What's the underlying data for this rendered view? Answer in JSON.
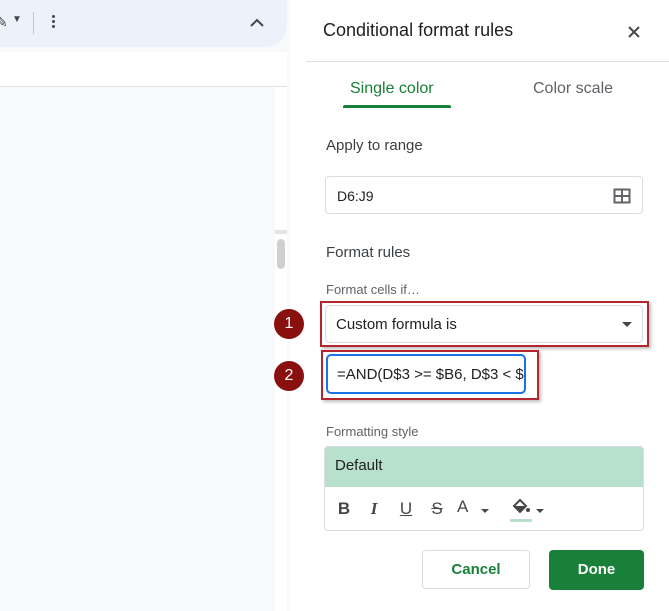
{
  "panel": {
    "title": "Conditional format rules",
    "close_icon": "close-icon",
    "tabs": [
      {
        "label": "Single color",
        "active": true
      },
      {
        "label": "Color scale",
        "active": false
      }
    ],
    "apply_to_range": {
      "heading": "Apply to range",
      "value": "D6:J9",
      "icon": "select-range-grid-icon"
    },
    "format_rules": {
      "heading": "Format rules",
      "condition_label": "Format cells if…",
      "condition_value": "Custom formula is",
      "formula_value": "=AND(D$3 >= $B6, D$3 < $"
    },
    "formatting_style": {
      "label": "Formatting style",
      "preview_text": "Default",
      "preview_color": "#b7e1cd",
      "tools": [
        "bold-icon",
        "italic-icon",
        "underline-icon",
        "strikethrough-icon",
        "text-color-icon",
        "fill-color-icon"
      ],
      "bold_label": "B",
      "italic_label": "I",
      "underline_label": "U",
      "strike_label": "S",
      "text_color_label": "A"
    },
    "buttons": {
      "cancel": "Cancel",
      "done": "Done"
    }
  },
  "annotations": {
    "badge_1": "1",
    "badge_2": "2",
    "highlight_color": "#b3262e"
  },
  "colors": {
    "accent_green": "#188038",
    "focus_blue": "#1a73e8"
  }
}
